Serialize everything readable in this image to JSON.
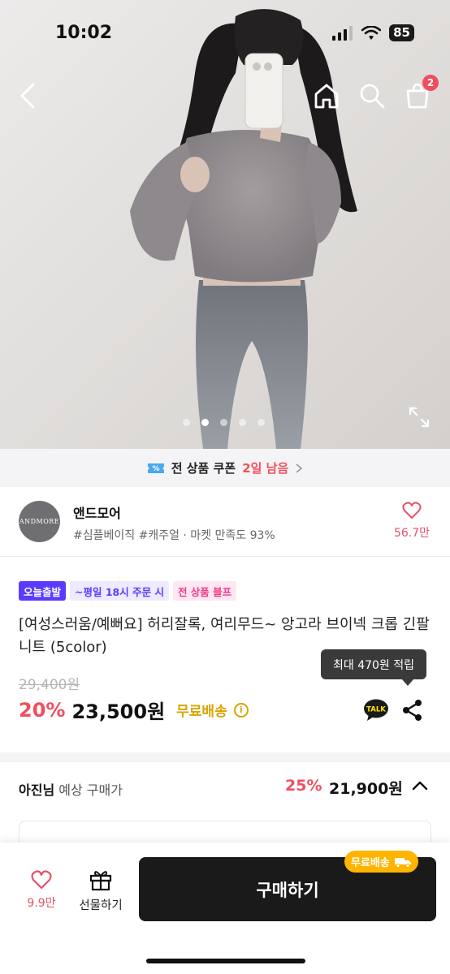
{
  "status_bar": {
    "time": "10:02",
    "battery": "85"
  },
  "nav": {
    "cart_count": "2"
  },
  "hero": {
    "image_count": 5,
    "active_index": 1
  },
  "coupon": {
    "text": "전 상품 쿠폰",
    "days_left": "2일 남음"
  },
  "store": {
    "logo_text": "ANDMORE",
    "name": "앤드모어",
    "tags": "#심플베이직 #캐주얼 · 마켓 만족도 93%",
    "like_count": "56.7만"
  },
  "badges": {
    "today_ship": "오늘출발",
    "cutoff": "~평일 18시 주문 시",
    "sale": "전 상품 블프"
  },
  "product": {
    "title": "[여성스러움/예뻐요] 허리잘록, 여리무드~ 앙고라 브이넥 크롭 긴팔니트 (5color)",
    "points_tooltip": "최대 470원 적립",
    "original_price": "29,400원",
    "discount": "20%",
    "price": "23,500원",
    "shipping": "무료배송",
    "talk_label": "TALK"
  },
  "expected": {
    "user": "아진님",
    "label": " 예상 구매가",
    "discount": "25%",
    "price": "21,900원"
  },
  "bottom_bar": {
    "like_count": "9.9만",
    "gift_label": "선물하기",
    "buy_label": "구매하기",
    "free_ship_tag": "무료배송"
  },
  "colors": {
    "accent_red": "#f04e5e",
    "brand_purple": "#5a3bff",
    "free_ship_yellow": "#ffb400",
    "buy_button": "#1a1a1a"
  }
}
